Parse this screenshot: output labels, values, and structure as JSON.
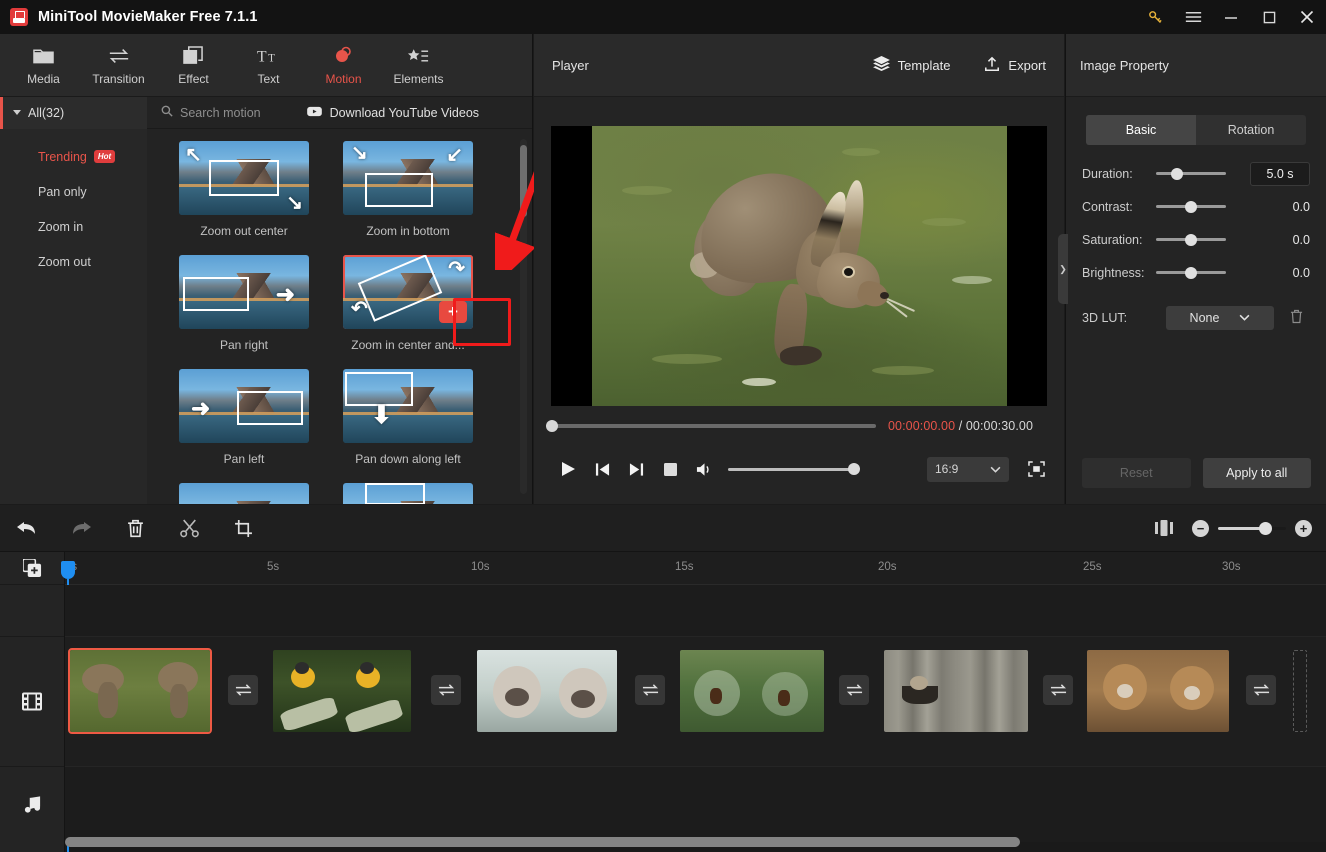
{
  "titlebar": {
    "app_title": "MiniTool MovieMaker Free 7.1.1",
    "key_icon": "key-icon",
    "menu_icon": "hamburger-menu-icon",
    "minimize_icon": "minimize-icon",
    "maximize_icon": "maximize-icon",
    "close_icon": "close-icon"
  },
  "tabs": [
    {
      "label": "Media",
      "icon": "folder-icon",
      "active": false
    },
    {
      "label": "Transition",
      "icon": "transition-arrows-icon",
      "active": false
    },
    {
      "label": "Effect",
      "icon": "effect-layers-icon",
      "active": false
    },
    {
      "label": "Text",
      "icon": "text-tt-icon",
      "active": false
    },
    {
      "label": "Motion",
      "icon": "motion-ball-icon",
      "active": true
    },
    {
      "label": "Elements",
      "icon": "elements-star-icon",
      "active": false
    }
  ],
  "filterbar": {
    "all_label": "All(32)",
    "search_placeholder": "Search motion",
    "search_icon": "search-icon",
    "download_label": "Download YouTube Videos",
    "download_icon": "youtube-download-icon"
  },
  "categories": [
    {
      "label": "Trending",
      "badge": "Hot",
      "highlight": true
    },
    {
      "label": "Pan only",
      "badge": "",
      "highlight": false
    },
    {
      "label": "Zoom in",
      "badge": "",
      "highlight": false
    },
    {
      "label": "Zoom out",
      "badge": "",
      "highlight": false
    }
  ],
  "motions": [
    {
      "label": "Zoom out center",
      "selected": false
    },
    {
      "label": "Zoom in bottom",
      "selected": false
    },
    {
      "label": "Pan right",
      "selected": false
    },
    {
      "label": "Zoom in center and...",
      "selected": true
    },
    {
      "label": "Pan left",
      "selected": false
    },
    {
      "label": "Pan down along left",
      "selected": false
    }
  ],
  "annotation": {
    "plus_label": "+",
    "arrow_color": "#f01b1b",
    "highlight_color": "#f01b1b"
  },
  "player": {
    "title": "Player",
    "template_label": "Template",
    "template_icon": "layers-icon",
    "export_label": "Export",
    "export_icon": "upload-icon",
    "current_time": "00:00:00.00",
    "separator": " / ",
    "total_time": "00:00:30.00",
    "current_time_color": "#e8544a",
    "aspect_ratio": "16:9",
    "preview_subject": "brown-hare-on-grass",
    "controls": [
      {
        "icon": "play-icon",
        "name": "play-button"
      },
      {
        "icon": "previous-frame-icon",
        "name": "previous-button"
      },
      {
        "icon": "next-frame-icon",
        "name": "next-button"
      },
      {
        "icon": "stop-icon",
        "name": "stop-button"
      },
      {
        "icon": "volume-icon",
        "name": "volume-button"
      }
    ],
    "fullscreen_icon": "fullscreen-icon"
  },
  "properties": {
    "title": "Image Property",
    "tabs": [
      {
        "label": "Basic",
        "active": true
      },
      {
        "label": "Rotation",
        "active": false
      }
    ],
    "rows": [
      {
        "label": "Duration:",
        "value": "5.0 s",
        "boxed": true,
        "knob": 30
      },
      {
        "label": "Contrast:",
        "value": "0.0",
        "boxed": false,
        "knob": 50
      },
      {
        "label": "Saturation:",
        "value": "0.0",
        "boxed": false,
        "knob": 50
      },
      {
        "label": "Brightness:",
        "value": "0.0",
        "boxed": false,
        "knob": 50
      }
    ],
    "lut_label": "3D LUT:",
    "lut_value": "None",
    "lut_delete_icon": "trash-icon",
    "reset_label": "Reset",
    "reset_enabled": false,
    "apply_label": "Apply to all",
    "apply_enabled": true
  },
  "timeline_toolbar": {
    "buttons": [
      {
        "icon": "undo-icon",
        "name": "undo-button",
        "enabled": true
      },
      {
        "icon": "redo-icon",
        "name": "redo-button",
        "enabled": false
      },
      {
        "icon": "delete-icon",
        "name": "delete-button",
        "enabled": true
      },
      {
        "icon": "split-scissors-icon",
        "name": "split-button",
        "enabled": true
      },
      {
        "icon": "crop-icon",
        "name": "crop-button",
        "enabled": true
      }
    ],
    "fit_icon": "fit-timeline-icon",
    "zoom_out_label": "−",
    "zoom_in_label": "+",
    "zoom_level": 60
  },
  "timeline": {
    "add_media_icon": "add-media-icon",
    "video_track_icon": "film-strip-icon",
    "audio_track_icon": "music-note-icon",
    "ruler_ticks": [
      "0s",
      "5s",
      "10s",
      "15s",
      "20s",
      "25s",
      "30s"
    ],
    "playhead_time": "0s",
    "clips": [
      {
        "name": "hare-clip",
        "subject": "hare",
        "selected": true
      },
      {
        "name": "bird-clip",
        "subject": "bird",
        "selected": false
      },
      {
        "name": "dog-clip",
        "subject": "dog",
        "selected": false
      },
      {
        "name": "spider-web-clip",
        "subject": "web",
        "selected": false
      },
      {
        "name": "bird-feeder-clip",
        "subject": "feeder",
        "selected": false
      },
      {
        "name": "squirrel-clip",
        "subject": "squirrel",
        "selected": false
      }
    ],
    "transition_icon": "transition-swap-icon",
    "transition_count": 5
  }
}
